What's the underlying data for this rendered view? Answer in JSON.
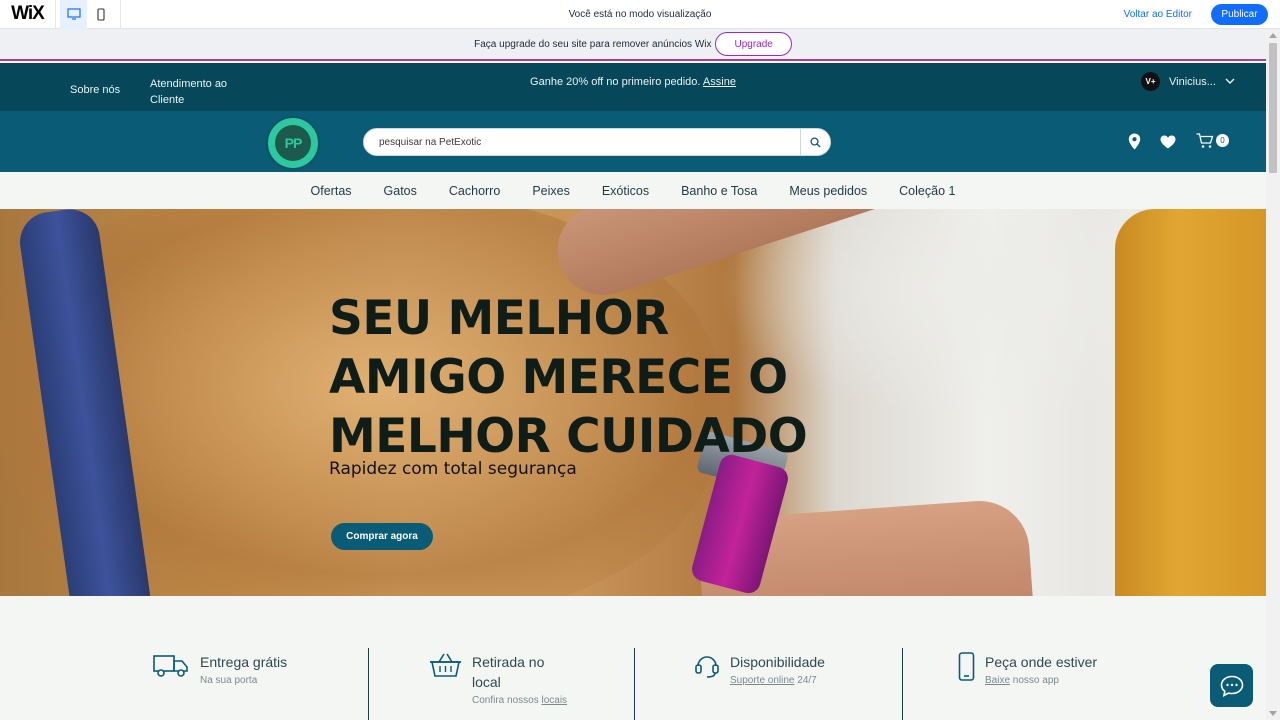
{
  "wix_bar": {
    "logo": "WiX",
    "preview_notice": "Você está no modo visualização",
    "back_to_editor": "Voltar ao Editor",
    "publish": "Publicar"
  },
  "upgrade_banner": {
    "text": "Faça upgrade do seu site para remover anúncios Wix",
    "button": "Upgrade"
  },
  "top_strip": {
    "about": "Sobre nós",
    "support": "Atendimento ao Cliente",
    "promo_text": "Ganhe 20% off no primeiro pedido.",
    "promo_link": "Assine",
    "user_name": "Vinicius...",
    "avatar_initials": "V+"
  },
  "header": {
    "logo_text": "PP",
    "search_placeholder": "pesquisar na PetExotic",
    "cart_count": "0"
  },
  "nav": [
    "Ofertas",
    "Gatos",
    "Cachorro",
    "Peixes",
    "Exóticos",
    "Banho e Tosa",
    "Meus pedidos",
    "Coleção 1"
  ],
  "hero": {
    "title": "SEU MELHOR AMIGO MERECE O MELHOR CUIDADO",
    "subtitle": "Rapidez com total segurança",
    "cta": "Comprar agora"
  },
  "features": [
    {
      "title": "Entrega grátis",
      "desc": "Na sua porta",
      "icon": "truck-icon"
    },
    {
      "title": "Retirada no local",
      "desc_prefix": "Confira nossos ",
      "desc_link": "locais",
      "icon": "basket-icon"
    },
    {
      "title": "Disponibilidade",
      "desc_link": "Suporte online",
      "desc_suffix": " 24/7",
      "icon": "headset-icon"
    },
    {
      "title": "Peça onde estiver",
      "desc_link": "Baixe",
      "desc_suffix": " nosso app",
      "icon": "phone-icon"
    }
  ],
  "colors": {
    "brand_dark": "#06485a",
    "brand": "#0a5b76",
    "wix_blue": "#116dff",
    "upgrade_purple": "#9a27d5"
  }
}
